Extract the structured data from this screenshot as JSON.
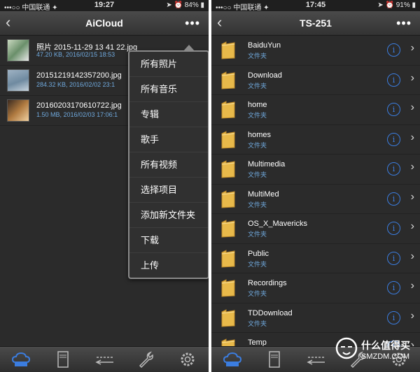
{
  "left": {
    "status": {
      "carrier": "•••○○ 中国联通 ✦",
      "time": "19:27",
      "right": "➤ ⏰ 84% ▮"
    },
    "title": "AiCloud",
    "files": [
      {
        "name": "照片 2015-11-29 13 41 22.jpg",
        "meta": "47.20 KB, 2016/02/15 18:53"
      },
      {
        "name": "20151219142357200.jpg",
        "meta": "284.32 KB, 2016/02/02 23:1"
      },
      {
        "name": "20160203170610722.jpg",
        "meta": "1.50 MB, 2016/02/03 17:06:1"
      }
    ],
    "menu": [
      "所有照片",
      "所有音乐",
      "专辑",
      "歌手",
      "所有视频",
      "选择项目",
      "添加新文件夹",
      "下载",
      "上传"
    ]
  },
  "right": {
    "status": {
      "carrier": "•••○○ 中国联通 ✦",
      "time": "17:45",
      "right": "➤ ⏰ 91% ▮"
    },
    "title": "TS-251",
    "folder_sub": "文件夹",
    "folders": [
      "BaiduYun",
      "Download",
      "home",
      "homes",
      "Multimedia",
      "MultiMed",
      "OS_X_Mavericks",
      "Public",
      "Recordings",
      "TDDownload",
      "Temp"
    ]
  },
  "watermark": {
    "text": "什么值得买",
    "sub": "SMZDM.COM"
  },
  "back_glyph": "‹",
  "more_glyph": "•••",
  "chevron_glyph": "›",
  "info_glyph": "i"
}
